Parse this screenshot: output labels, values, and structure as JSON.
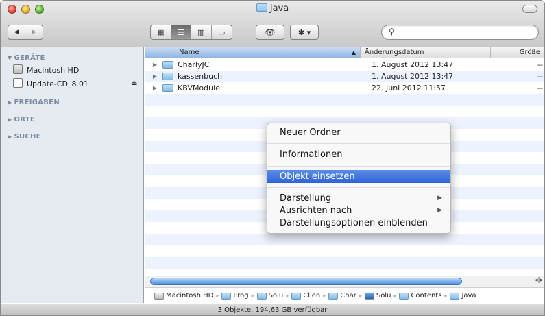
{
  "window": {
    "title": "Java"
  },
  "toolbar": {
    "back_label": "◀",
    "forward_label": "▶",
    "view_icon": "▦",
    "view_list": "☰",
    "view_columns": "▥",
    "view_coverflow": "▭",
    "quicklook": "👁",
    "action": "✱ ▾",
    "search_placeholder": ""
  },
  "sidebar": {
    "sections": [
      {
        "label": "GERÄTE",
        "expanded": true
      },
      {
        "label": "FREIGABEN",
        "expanded": false
      },
      {
        "label": "ORTE",
        "expanded": false
      },
      {
        "label": "SUCHE",
        "expanded": false
      }
    ],
    "devices": [
      {
        "label": "Macintosh HD",
        "icon": "harddisk-icon"
      },
      {
        "label": "Update-CD_8.01",
        "icon": "disk-image-icon",
        "eject": "⏏"
      }
    ]
  },
  "list": {
    "columns": {
      "name": "Name",
      "date": "Änderungsdatum",
      "size": "Größe"
    },
    "rows": [
      {
        "name": "CharlyJC",
        "date": "1. August 2012 13:47",
        "size": "--"
      },
      {
        "name": "kassenbuch",
        "date": "1. August 2012 13:47",
        "size": "--"
      },
      {
        "name": "KBVModule",
        "date": "22. Juni 2012 11:57",
        "size": "--"
      }
    ]
  },
  "context_menu": {
    "items": [
      {
        "label": "Neuer Ordner"
      },
      {
        "label": "Informationen"
      },
      {
        "label": "Objekt einsetzen",
        "highlighted": true
      },
      {
        "label": "Darstellung",
        "submenu": true
      },
      {
        "label": "Ausrichten nach",
        "submenu": true
      },
      {
        "label": "Darstellungsoptionen einblenden"
      }
    ]
  },
  "pathbar": {
    "items": [
      "Macintosh HD",
      "Prog",
      "Solu",
      "Clien",
      "Char",
      "Solu",
      "Contents",
      "Java"
    ]
  },
  "status": {
    "text": "3 Objekte, 194,63 GB verfügbar"
  },
  "colors": {
    "selection": "#2d63d8",
    "sidebar_bg": "#e6ebf2",
    "row_stripe": "#edf3fe"
  }
}
